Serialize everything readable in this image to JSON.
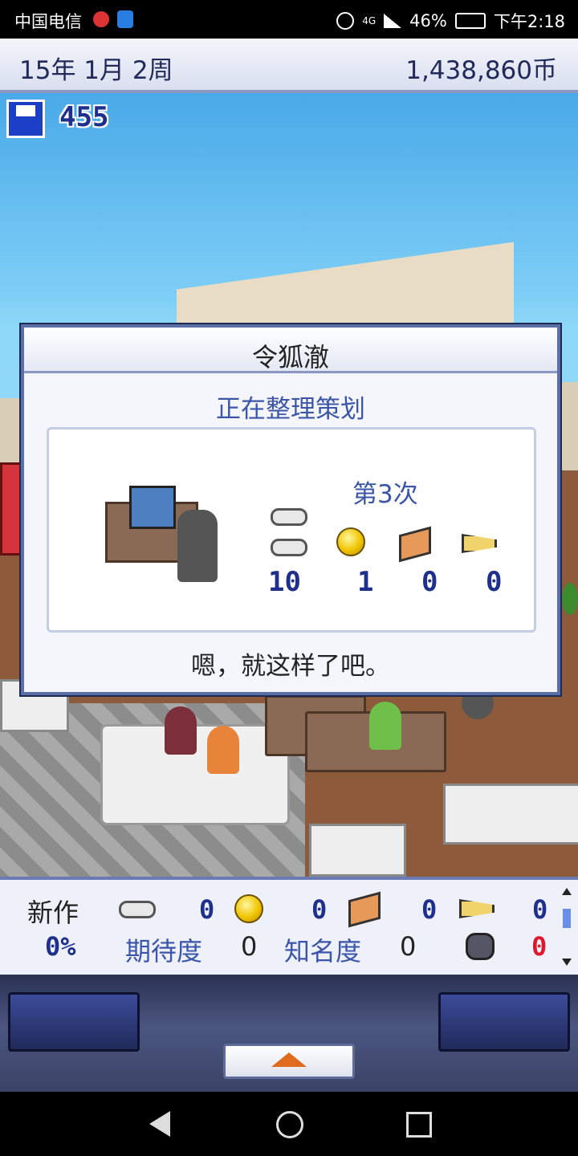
{
  "status_bar": {
    "carrier": "中国电信",
    "network": "4G",
    "battery": "46%",
    "time": "下午2:18"
  },
  "header": {
    "date": "15年 1月 2周",
    "money": "1,438,860币"
  },
  "save_counter": {
    "value": "455",
    "icon": "floppy-disk-icon"
  },
  "dialog": {
    "title": "令狐澈",
    "subtitle": "正在整理策划",
    "count": "第3次",
    "stats": [
      {
        "icon": "gamepad-icon",
        "value": "10"
      },
      {
        "icon": "coin-icon",
        "value": "1"
      },
      {
        "icon": "brush-icon",
        "value": "0"
      },
      {
        "icon": "trumpet-icon",
        "value": "0"
      }
    ],
    "message": "嗯，就这样了吧。"
  },
  "info_panel": {
    "label": "新作",
    "progress": "0%",
    "stats": [
      {
        "icon": "gamepad-icon",
        "value": "0"
      },
      {
        "icon": "coin-icon",
        "value": "0"
      },
      {
        "icon": "brush-icon",
        "value": "0"
      },
      {
        "icon": "trumpet-icon",
        "value": "0"
      }
    ],
    "expectation_label": "期待度",
    "expectation_value": "0",
    "fame_label": "知名度",
    "fame_value": "0",
    "bug_value": "0",
    "bug_icon": "bug-monster-icon"
  },
  "colors": {
    "accent_blue": "#3b55a8",
    "number_navy": "#1f2f8c",
    "bug_red": "#e0162b"
  }
}
